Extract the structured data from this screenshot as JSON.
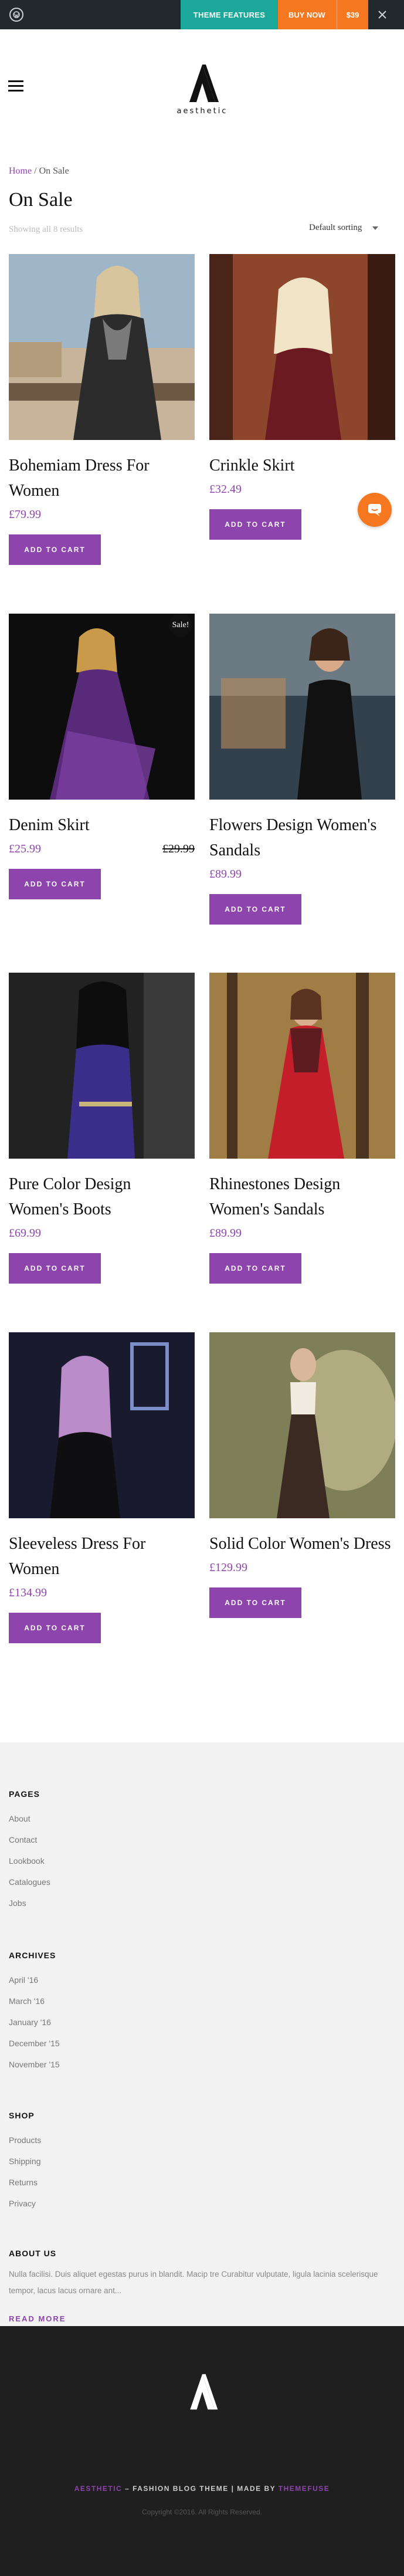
{
  "topbar": {
    "logo_icon": "wordpress-icon",
    "features_label": "THEME FEATURES",
    "buy_label": "BUY NOW",
    "price": "$39",
    "close_icon": "close-icon",
    "features_color": "#1ba89a",
    "buy_color": "#f5771f"
  },
  "header": {
    "menu_icon": "hamburger-menu-icon",
    "logo_text": "aesthetic"
  },
  "breadcrumb": {
    "home": "Home",
    "separator": " / ",
    "current": "On Sale"
  },
  "page": {
    "title": "On Sale",
    "results": "Showing all 8 results",
    "sort_label": "Default sorting"
  },
  "accent_color": "#8e44ad",
  "products": [
    {
      "name": "Bohemiam Dress For Women",
      "price": "£79.99",
      "old_price": "",
      "sale": "",
      "button": "ADD TO CART"
    },
    {
      "name": "Crinkle Skirt",
      "price": "£32.49",
      "old_price": "",
      "sale": "",
      "button": "ADD TO CART"
    },
    {
      "name": "Denim Skirt",
      "price": "£25.99",
      "old_price": "£29.99",
      "sale": "Sale!",
      "button": "ADD TO CART"
    },
    {
      "name": "Flowers Design Women's Sandals",
      "price": "£89.99",
      "old_price": "",
      "sale": "",
      "button": "ADD TO CART"
    },
    {
      "name": "Pure Color Design Women's Boots",
      "price": "£69.99",
      "old_price": "",
      "sale": "",
      "button": "ADD TO CART"
    },
    {
      "name": "Rhinestones Design Women's Sandals",
      "price": "£89.99",
      "old_price": "",
      "sale": "",
      "button": "ADD TO CART"
    },
    {
      "name": "Sleeveless Dress For Women",
      "price": "£134.99",
      "old_price": "",
      "sale": "",
      "button": "ADD TO CART"
    },
    {
      "name": "Solid Color Women's Dress",
      "price": "£129.99",
      "old_price": "",
      "sale": "",
      "button": "ADD TO CART"
    }
  ],
  "chat_icon": "chat-bubble-icon",
  "footer": {
    "pages": {
      "heading": "PAGES",
      "items": [
        "About",
        "Contact",
        "Lookbook",
        "Catalogues",
        "Jobs"
      ]
    },
    "archives": {
      "heading": "ARCHIVES",
      "items": [
        "April '16",
        "March '16",
        "January '16",
        "December '15",
        "November '15"
      ]
    },
    "shop": {
      "heading": "SHOP",
      "items": [
        "Products",
        "Shipping",
        "Returns",
        "Privacy"
      ]
    },
    "about": {
      "heading": "ABOUT US",
      "text": "Nulla facilisi. Duis aliquet egestas purus in blandit. Macip tre Curabitur vulputate, ligula lacinia scelerisque tempor, lacus lacus ornare ant...",
      "read_more": "READ MORE"
    }
  },
  "bottom": {
    "brand": "AESTHETIC",
    "middle": " – FASHION BLOG THEME | MADE BY ",
    "maker": "THEMEFUSE",
    "copyright": "Copyright ©2016. All Rights Reserved."
  }
}
